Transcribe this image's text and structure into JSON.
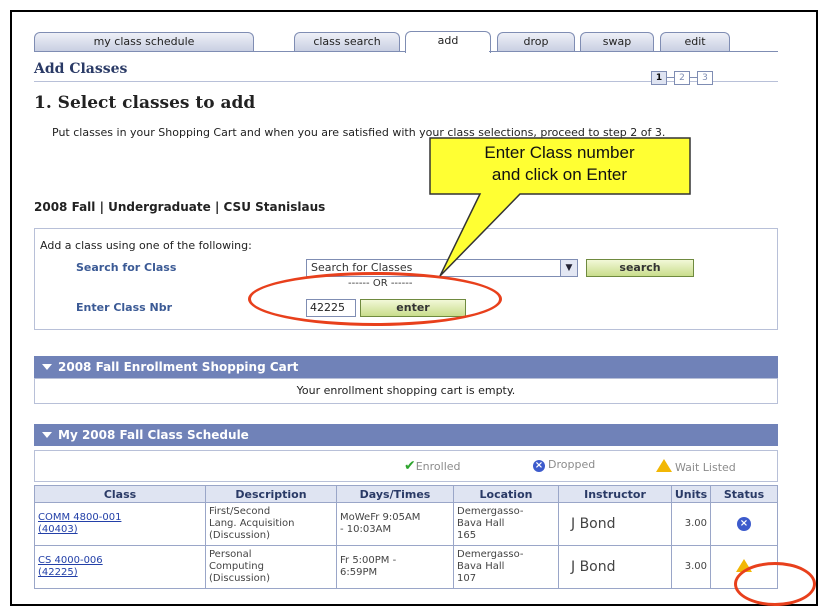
{
  "tabs": [
    "my class schedule",
    "class search",
    "add",
    "drop",
    "swap",
    "edit"
  ],
  "active_tab": "add",
  "page_title": "Add Classes",
  "steps": [
    "1",
    "2",
    "3"
  ],
  "step_heading": "1.  Select classes to add",
  "intro": "Put classes in your Shopping Cart and when you are satisfied with your class selections, proceed to step 2 of 3.",
  "term": "2008 Fall | Undergraduate | CSU Stanislaus",
  "callout": {
    "line1": "Enter Class number",
    "line2": "and click on Enter"
  },
  "add_box": {
    "header": "Add a class using one of the following:",
    "search_label": "Search for Class",
    "search_select_value": "Search for Classes",
    "search_button": "search",
    "or_text": "------ OR ------",
    "class_nbr_label": "Enter Class Nbr",
    "class_nbr_value": "42225",
    "enter_button": "enter"
  },
  "cart": {
    "title": "2008 Fall Enrollment Shopping Cart",
    "empty_message": "Your enrollment shopping cart is empty."
  },
  "schedule": {
    "title": "My 2008 Fall Class Schedule",
    "legend": {
      "enrolled": "Enrolled",
      "dropped": "Dropped",
      "wait_listed": "Wait Listed"
    },
    "columns": [
      "Class",
      "Description",
      "Days/Times",
      "Location",
      "Instructor",
      "Units",
      "Status"
    ],
    "rows": [
      {
        "class_line1": "COMM 4800-001",
        "class_line2": "(40403)",
        "desc1": "First/Second",
        "desc2": "Lang. Acquisition",
        "desc3": "(Discussion)",
        "days1": "MoWeFr 9:05AM",
        "days2": "- 10:03AM",
        "loc1": "Demergasso-",
        "loc2": "Bava Hall",
        "loc3": "165",
        "instructor": "J Bond",
        "units": "3.00",
        "status": "dropped"
      },
      {
        "class_line1": "CS 4000-006",
        "class_line2": "(42225)",
        "desc1": "Personal",
        "desc2": "Computing",
        "desc3": "(Discussion)",
        "days1": "Fr 5:00PM -",
        "days2": "6:59PM",
        "loc1": "Demergasso-",
        "loc2": "Bava Hall",
        "loc3": "107",
        "instructor": "J Bond",
        "units": "3.00",
        "status": "wait_listed"
      }
    ]
  },
  "colors": {
    "section_bar": "#7082b8",
    "highlight_oval": "#e8401c",
    "callout_fill": "#ffff33",
    "button_green": "#c9dd8c"
  }
}
